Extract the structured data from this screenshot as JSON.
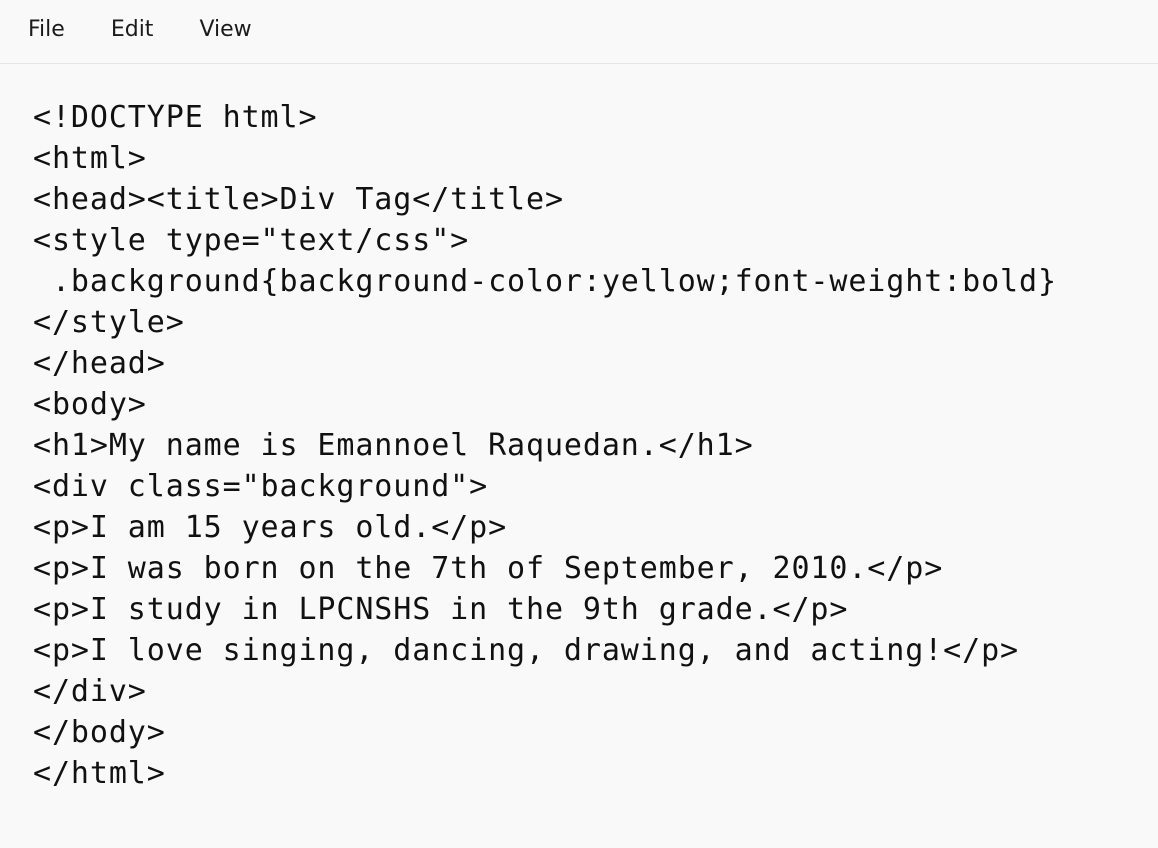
{
  "menu": {
    "file": "File",
    "edit": "Edit",
    "view": "View"
  },
  "editor": {
    "lines": [
      "<!DOCTYPE html>",
      "<html>",
      "<head><title>Div Tag</title>",
      "<style type=\"text/css\">",
      " .background{background-color:yellow;font-weight:bold}",
      "</style>",
      "</head>",
      "<body>",
      "<h1>My name is Emannoel Raquedan.</h1>",
      "<div class=\"background\">",
      "<p>I am 15 years old.</p>",
      "<p>I was born on the 7th of September, 2010.</p>",
      "<p>I study in LPCNSHS in the 9th grade.</p>",
      "<p>I love singing, dancing, drawing, and acting!</p>",
      "</div>",
      "</body>",
      "</html>"
    ]
  }
}
